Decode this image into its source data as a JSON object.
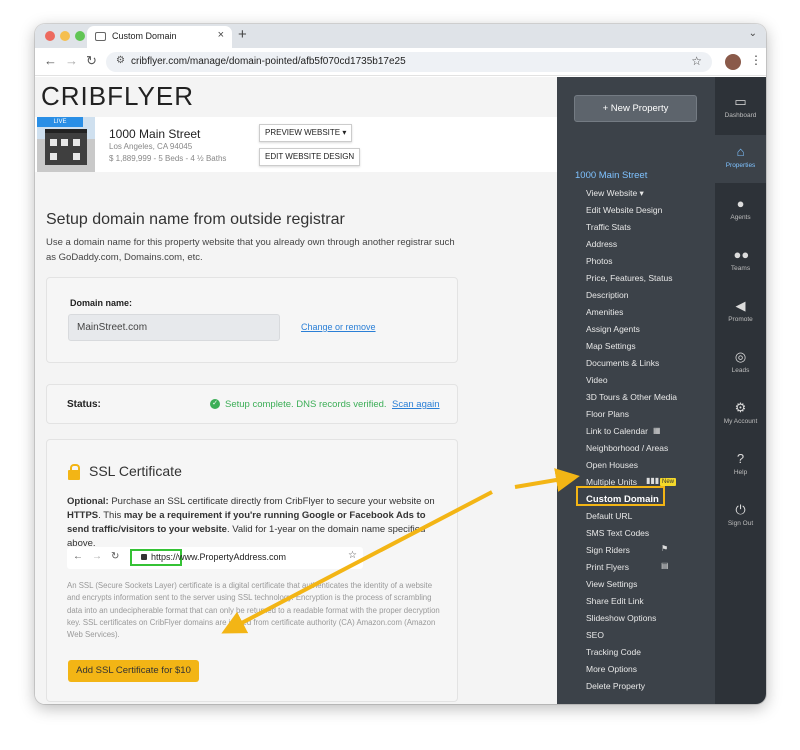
{
  "browser": {
    "tab_title": "Custom Domain",
    "url": "cribflyer.com/manage/domain-pointed/afb5f070cd1735b17e25"
  },
  "app": {
    "logo": "CRIBFLYER"
  },
  "property": {
    "badge": "LIVE",
    "address": "1000 Main Street",
    "city": "Los Angeles, CA 94045",
    "details": "$ 1,889,999 - 5 Beds - 4 ½ Baths",
    "preview_button": "PREVIEW WEBSITE ▾",
    "edit_button": "EDIT WEBSITE DESIGN"
  },
  "page": {
    "title": "Setup domain name from outside registrar",
    "intro": "Use a domain name for this property website that you already own through another registrar such as GoDaddy.com, Domains.com, etc."
  },
  "domain": {
    "label": "Domain name:",
    "value": "MainStreet.com",
    "change_link": "Change or remove"
  },
  "status": {
    "label": "Status:",
    "text": "Setup complete. DNS records verified.",
    "rescan_link": "Scan again"
  },
  "ssl": {
    "title": "SSL Certificate",
    "desc_optional": "Optional:",
    "desc_1": " Purchase an SSL certificate directly from CribFlyer to secure your website on ",
    "desc_https": "HTTPS",
    "desc_2": ". This ",
    "desc_bold": "may be a requirement if you're running Google or Facebook Ads to send traffic/visitors to your website",
    "desc_3": ". Valid for 1-year on the domain name specified above.",
    "example_scheme": "https://",
    "example_url": "www.PropertyAddress.com",
    "fine_print": "An SSL (Secure Sockets Layer) certificate is a digital certificate that authenticates the identity of a website and encrypts information sent to the server using SSL technology. Encryption is the process of scrambling data into an undecipherable format that can only be returned to a readable format with the proper decryption key. SSL certificates on CribFlyer domains are issued from certificate authority (CA) Amazon.com (Amazon Web Services).",
    "button": "Add SSL Certificate for $10"
  },
  "sidebar": {
    "new_property": "+ New Property",
    "property_title": "1000 Main Street",
    "items": [
      "View Website ▾",
      "Edit Website Design",
      "Traffic Stats",
      "Address",
      "Photos",
      "Price, Features, Status",
      "Description",
      "Amenities",
      "Assign Agents",
      "Map Settings",
      "Documents & Links",
      "Video",
      "3D Tours & Other Media",
      "Floor Plans",
      "Link to Calendar",
      "Neighborhood / Areas",
      "Open Houses",
      "Multiple Units",
      "Custom Domain",
      "Default URL",
      "SMS Text Codes",
      "Sign Riders",
      "Print Flyers",
      "View Settings",
      "Share Edit Link",
      "Slideshow Options",
      "SEO",
      "Tracking Code",
      "More Options",
      "Delete Property"
    ],
    "new_badge": "New"
  },
  "rail": {
    "items": [
      "Dashboard",
      "Properties",
      "Agents",
      "Teams",
      "Promote",
      "Leads",
      "My Account",
      "Help",
      "Sign Out"
    ]
  },
  "colors": {
    "accent": "#f3b515",
    "link": "#2a7fd6",
    "success": "#3cae57",
    "sidebar_bg": "#3c4249",
    "rail_bg": "#2d3238"
  }
}
